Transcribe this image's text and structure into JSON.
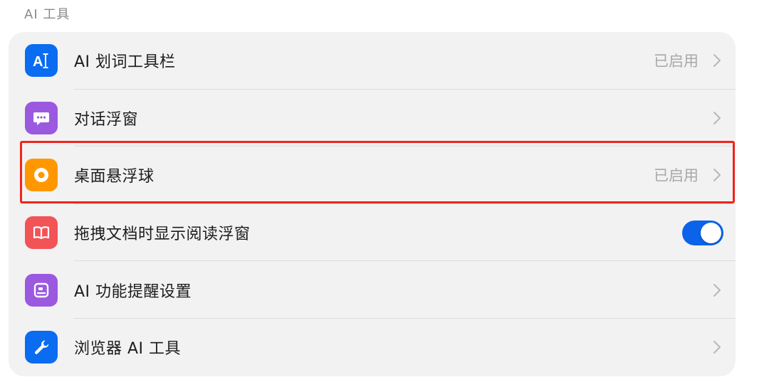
{
  "section": {
    "title": "AI 工具"
  },
  "colors": {
    "blue": "#0a6cf0",
    "purple": "#9b59e0",
    "orange": "#ff9800",
    "red": "#f25357",
    "toggle_on": "#0a63e8",
    "highlight": "#f0241b"
  },
  "rows": [
    {
      "label": "AI 划词工具栏",
      "status": "已启用",
      "icon": "ai-text-cursor-icon"
    },
    {
      "label": "对话浮窗",
      "status": "",
      "icon": "chat-bubble-icon"
    },
    {
      "label": "桌面悬浮球",
      "status": "已启用",
      "icon": "floating-ball-icon"
    },
    {
      "label": "拖拽文档时显示阅读浮窗",
      "toggle_on": true,
      "icon": "open-book-icon"
    },
    {
      "label": "AI 功能提醒设置",
      "status": "",
      "icon": "reminder-tablet-icon"
    },
    {
      "label": "浏览器 AI 工具",
      "status": "",
      "icon": "wrench-icon"
    }
  ],
  "icon_glyphs": {
    "ai_text": "A"
  }
}
